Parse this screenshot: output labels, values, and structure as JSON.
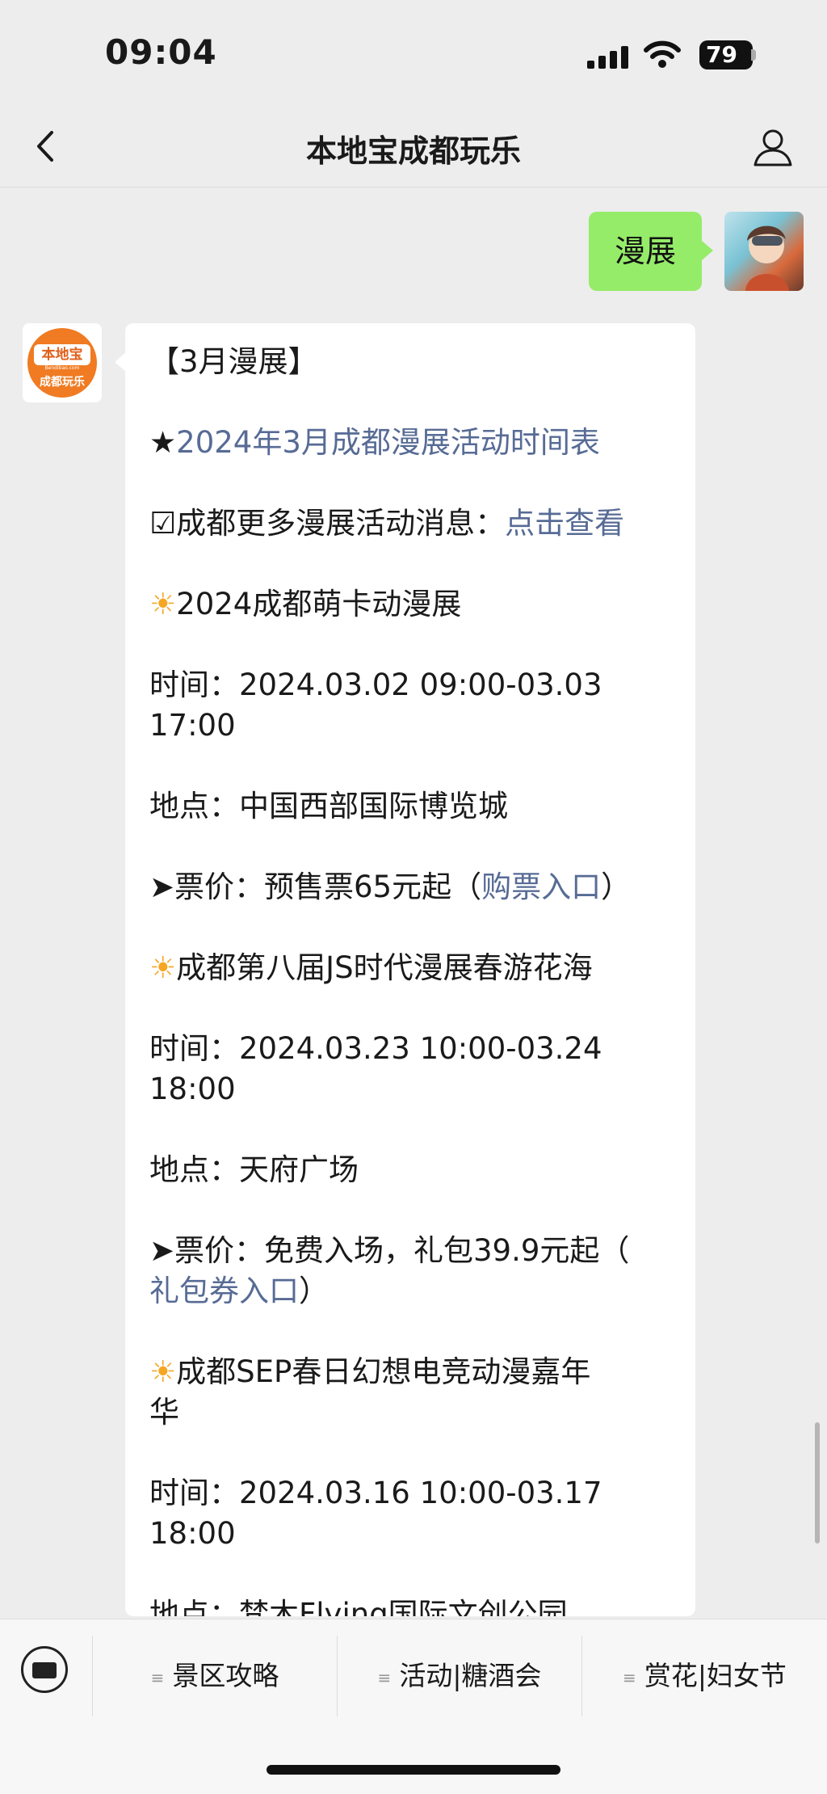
{
  "status_bar": {
    "time": "09:04",
    "battery": "79"
  },
  "nav": {
    "title": "本地宝成都玩乐"
  },
  "user_message": {
    "text": "漫展"
  },
  "bot_avatar": {
    "logo_top": "本地宝",
    "logo_url": "Bendibao.com",
    "logo_bottom": "成都玩乐"
  },
  "bot_message": {
    "heading": "【3月漫展】",
    "schedule_prefix": "★",
    "schedule_link": "2024年3月成都漫展活动时间表",
    "more_prefix": "☑成都更多漫展活动消息：",
    "more_link": "点击查看",
    "events": [
      {
        "icon": "☀",
        "name": "2024成都萌卡动漫展",
        "time_line1": "时间：2024.03.02 09:00-03.03",
        "time_line2": "17:00",
        "place": "地点：中国西部国际博览城",
        "price_prefix": "➤票价：预售票65元起（",
        "price_link": "购票入口",
        "price_suffix": "）"
      },
      {
        "icon": "☀",
        "name": "成都第八届JS时代漫展春游花海",
        "time_line1": "时间：2024.03.23 10:00-03.24",
        "time_line2": "18:00",
        "place": "地点：天府广场",
        "price_prefix": "➤票价：免费入场，礼包39.9元起（",
        "price_link": "礼包券入口",
        "price_suffix": "）"
      },
      {
        "icon": "☀",
        "name_line1": "成都SEP春日幻想电竞动漫嘉年",
        "name_line2": "华",
        "time_line1": "时间：2024.03.16 10:00-03.17",
        "time_line2": "18:00",
        "place": "地点：梵木Flying国际文创公园"
      }
    ]
  },
  "menu": {
    "items": [
      {
        "label": "景区攻略"
      },
      {
        "label": "活动|糖酒会"
      },
      {
        "label": "赏花|妇女节"
      }
    ]
  }
}
